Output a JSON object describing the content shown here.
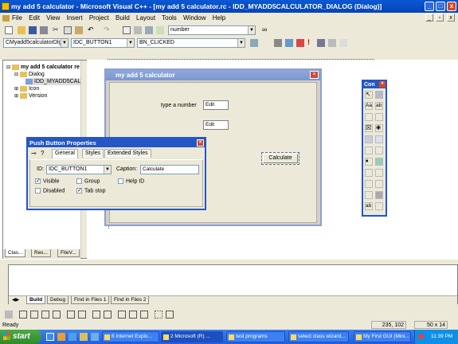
{
  "titlebar": {
    "title": "my add 5 calculator - Microsoft Visual C++ - [my add 5 calculator.rc - IDD_MYADD5CALCULATOR_DIALOG (Dialog)]"
  },
  "menu": [
    "File",
    "Edit",
    "View",
    "Insert",
    "Project",
    "Build",
    "Layout",
    "Tools",
    "Window",
    "Help"
  ],
  "toolbar": {
    "find_combo": "number"
  },
  "wizardbar": {
    "class_combo": "CMyadd5calculatorDlg",
    "id_combo": "IDC_BUTTON1",
    "msg_combo": "BN_CLICKED"
  },
  "workspace": {
    "tree": [
      "my add 5 calculator re",
      "Dialog",
      "IDD_MYADD5CAL",
      "Icon",
      "Version"
    ],
    "tabs": [
      "Clas...",
      "Res...",
      "FileV..."
    ]
  },
  "dialog": {
    "title": "my add 5 calculator",
    "label": "type a number",
    "edit1": "Edit",
    "edit2": "Edit",
    "button": "Calculate"
  },
  "props": {
    "title": "Push Button Properties",
    "tabs": [
      "General",
      "Styles",
      "Extended Styles"
    ],
    "id_label": "ID:",
    "id_value": "IDC_BUTTON1",
    "caption_label": "Caption:",
    "caption_value": "Calculate",
    "visible": "Visible",
    "group": "Group",
    "helpid": "Help ID",
    "disabled": "Disabled",
    "tabstop": "Tab stop"
  },
  "controls": {
    "title": "Con"
  },
  "output": {
    "tabs": [
      "Build",
      "Debug",
      "Find in Files 1",
      "Find in Files 2"
    ]
  },
  "status": {
    "text": "Ready",
    "coords": "235, 102",
    "size": "50 x 14"
  },
  "taskbar": {
    "start": "start",
    "tasks": [
      "6 Internet Explo...",
      "2 Microsoft (R) ...",
      "test programs",
      "select class wizard...",
      "My First GUI (Mini..."
    ],
    "clock": "11:39 PM"
  }
}
